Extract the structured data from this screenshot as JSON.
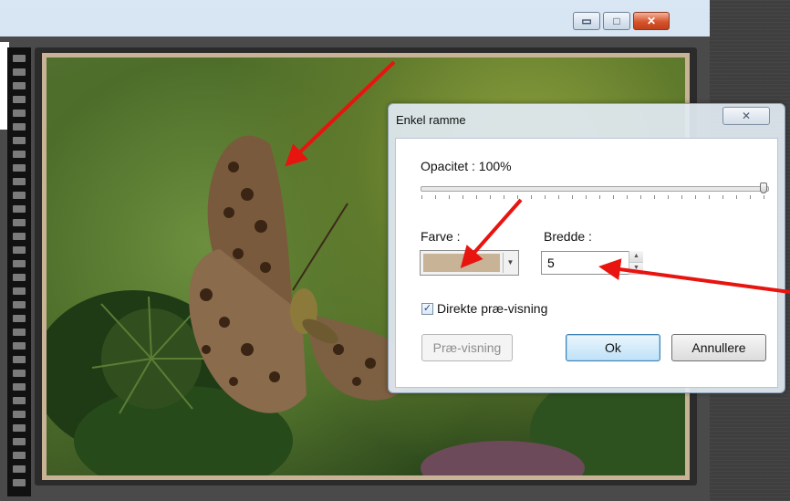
{
  "window": {
    "minimize_glyph": "▭",
    "maximize_glyph": "□",
    "close_glyph": "✕"
  },
  "dialog": {
    "title": "Enkel ramme",
    "close_glyph": "✕",
    "opacity_label": "Opacitet : 100%",
    "opacity_value": 100,
    "color_label": "Farve :",
    "color_value": "#c9b397",
    "width_label": "Bredde :",
    "width_value": "5",
    "live_preview_label": "Direkte præ-visning",
    "live_preview_checked": true,
    "preview_button": "Præ-visning",
    "ok_button": "Ok",
    "cancel_button": "Annullere"
  },
  "colors": {
    "frame_color": "#c9b397",
    "arrow_color": "#e8140f"
  }
}
